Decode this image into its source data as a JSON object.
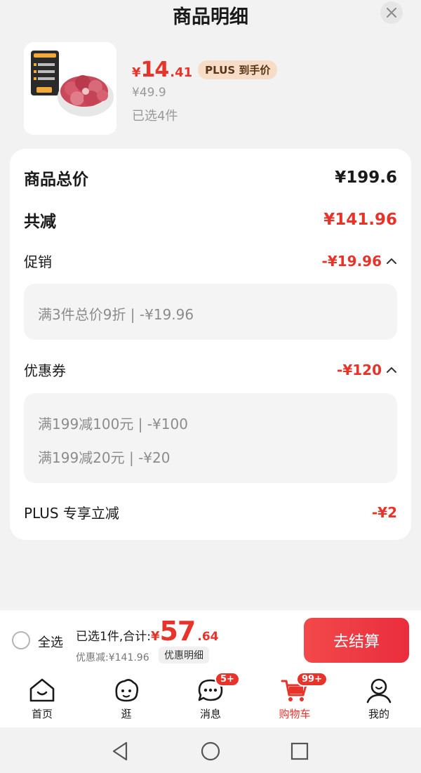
{
  "header": {
    "title": "商品明细",
    "close_icon": "close-icon"
  },
  "product": {
    "image_icon": "beef-cubes-image",
    "price_currency": "¥",
    "price_int": "14",
    "price_dec": ".41",
    "plus_tag": "PLUS 到手价",
    "original_price": "¥49.9",
    "selected_count": "已选4件"
  },
  "summary": {
    "total_label": "商品总价",
    "total_value": "¥199.6",
    "reduce_label": "共减",
    "reduce_value": "¥141.96",
    "promotion": {
      "label": "促销",
      "value": "-¥19.96",
      "items": [
        "满3件总价9折 | -¥19.96"
      ]
    },
    "coupon": {
      "label": "优惠券",
      "value": "-¥120",
      "items": [
        "满199减100元 | -¥100",
        "满199减20元 | -¥20"
      ]
    },
    "plus": {
      "label": "PLUS 专享立减",
      "value": "-¥2"
    }
  },
  "bottom_bar": {
    "select_all": "全选",
    "selected_total_label": "已选1件,合计:",
    "total_currency": "¥",
    "total_int": "57",
    "total_dec": ".64",
    "discount_text": "优惠减:¥141.96",
    "detail_button": "优惠明细",
    "checkout_button": "去结算"
  },
  "tabs": [
    {
      "label": "首页",
      "icon": "home-icon"
    },
    {
      "label": "逛",
      "icon": "browse-icon"
    },
    {
      "label": "消息",
      "icon": "message-icon",
      "badge": "5+"
    },
    {
      "label": "购物车",
      "icon": "cart-icon",
      "badge": "99+",
      "active": true
    },
    {
      "label": "我的",
      "icon": "profile-icon"
    }
  ],
  "colors": {
    "accent": "#e8332b",
    "background": "#f2f2f2",
    "plus_tag_bg": "#f7ddc7"
  }
}
